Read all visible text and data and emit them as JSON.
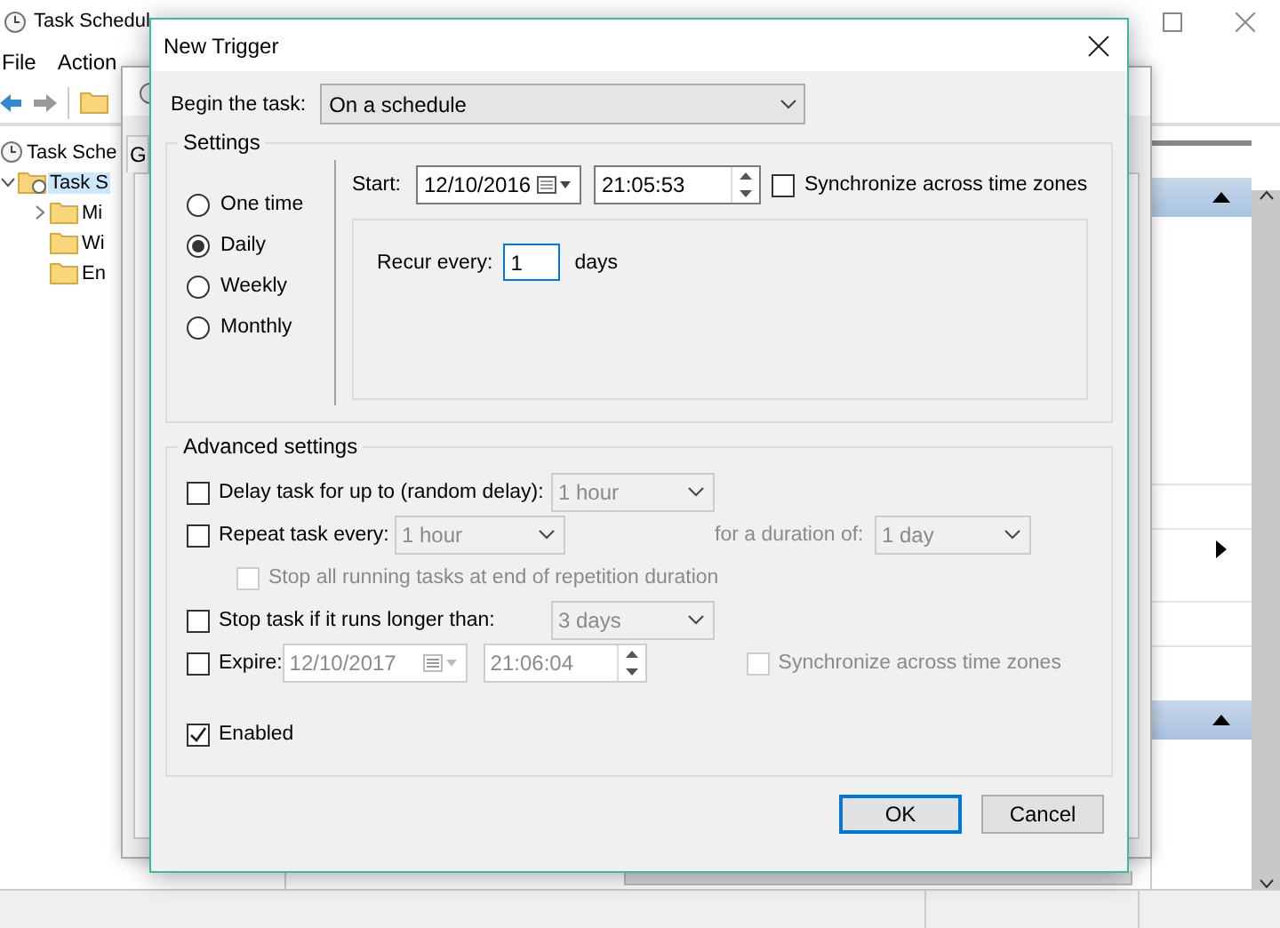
{
  "main_window": {
    "title": "Task Schedul",
    "menu": [
      {
        "label": "File"
      },
      {
        "label": "Action"
      }
    ],
    "tree": [
      {
        "label": "Task Sche",
        "selected": false,
        "children": [
          {
            "label": "Task S",
            "selected": true,
            "expanded": true,
            "children": [
              {
                "label": "Mi",
                "selected": false,
                "expanded": false
              },
              {
                "label": "Wi",
                "selected": false
              },
              {
                "label": "En",
                "selected": false
              }
            ]
          }
        ]
      }
    ]
  },
  "behind_dialog": {
    "tab": "G"
  },
  "dialog": {
    "title": "New Trigger",
    "begin_label": "Begin the task:",
    "begin_value": "On a schedule",
    "settings": {
      "title": "Settings",
      "schedules": [
        {
          "label": "One time",
          "selected": false
        },
        {
          "label": "Daily",
          "selected": true
        },
        {
          "label": "Weekly",
          "selected": false
        },
        {
          "label": "Monthly",
          "selected": false
        }
      ],
      "start_label": "Start:",
      "start_date": "12/10/2016",
      "start_time": "21:05:53",
      "sync": {
        "label": "Synchronize across time zones",
        "checked": false
      },
      "recur_label": "Recur every:",
      "recur_value": "1",
      "recur_unit": "days"
    },
    "advanced": {
      "title": "Advanced settings",
      "delay": {
        "label": "Delay task for up to (random delay):",
        "checked": false,
        "value": "1 hour"
      },
      "repeat": {
        "label": "Repeat task every:",
        "checked": false,
        "value": "1 hour",
        "duration_label": "for a duration of:",
        "duration_value": "1 day"
      },
      "stop_all": {
        "label": "Stop all running tasks at end of repetition duration",
        "checked": false,
        "disabled": true
      },
      "stop_task": {
        "label": "Stop task if it runs longer than:",
        "checked": false,
        "value": "3 days"
      },
      "expire": {
        "label": "Expire:",
        "checked": false,
        "date": "12/10/2017",
        "time": "21:06:04",
        "sync": {
          "label": "Synchronize across time zones",
          "checked": false,
          "disabled": true
        }
      },
      "enabled": {
        "label": "Enabled",
        "checked": true
      }
    },
    "buttons": [
      {
        "label": "OK",
        "default": true
      },
      {
        "label": "Cancel",
        "default": false
      }
    ]
  }
}
